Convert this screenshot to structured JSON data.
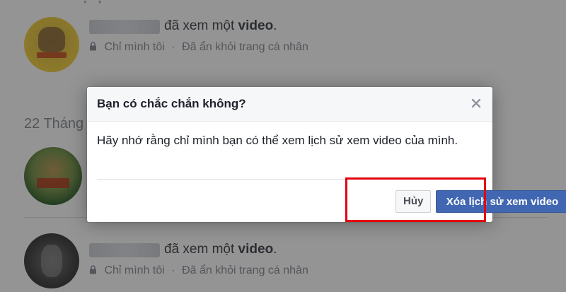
{
  "background": {
    "items": [
      {
        "action_text": "đã xem một",
        "object_text": "video",
        "suffix": ".",
        "privacy": "Chỉ mình tôi",
        "separator": "·",
        "status": "Đã ẩn khỏi trang cá nhân"
      },
      {
        "action_text": "đã xem một",
        "object_text": "video",
        "suffix": ".",
        "privacy": "Chỉ mình tôi",
        "separator": "·",
        "status": "Đã ẩn khỏi trang cá nhân"
      }
    ],
    "date_header": "22 Tháng"
  },
  "dialog": {
    "title": "Bạn có chắc chắn không?",
    "message": "Hãy nhớ rằng chỉ mình bạn có thể xem lịch sử xem video của mình.",
    "cancel_label": "Hủy",
    "confirm_label": "Xóa lịch sử xem video",
    "close_label": "×"
  },
  "colors": {
    "primary_button": "#4267b2",
    "highlight": "#e3000f",
    "text_primary": "#1d2129",
    "text_muted": "#90949c"
  },
  "icons": {
    "close": "close-icon",
    "privacy": "lock-icon"
  }
}
